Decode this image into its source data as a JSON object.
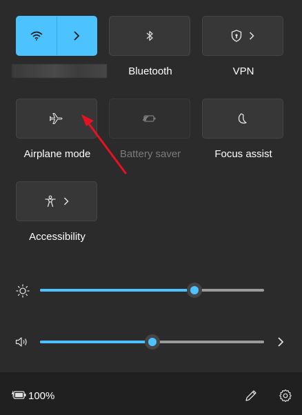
{
  "tiles": [
    {
      "label": "",
      "icon": "wifi-icon",
      "state": "active",
      "expand": true
    },
    {
      "label": "Bluetooth",
      "icon": "bluetooth-icon",
      "state": "off"
    },
    {
      "label": "VPN",
      "icon": "shield-icon",
      "state": "off",
      "expand": true
    },
    {
      "label": "Airplane mode",
      "icon": "airplane-icon",
      "state": "off"
    },
    {
      "label": "Battery saver",
      "icon": "battery-saver-icon",
      "state": "disabled"
    },
    {
      "label": "Focus assist",
      "icon": "moon-icon",
      "state": "off"
    },
    {
      "label": "Accessibility",
      "icon": "accessibility-icon",
      "state": "off",
      "expand": true
    }
  ],
  "sliders": {
    "brightness": {
      "icon": "sun-icon",
      "level": 0.69
    },
    "volume": {
      "icon": "speaker-icon",
      "level": 0.5
    }
  },
  "footer": {
    "battery_text": "100%",
    "battery_icon": "battery-charging-icon",
    "edit_icon": "pencil-icon",
    "settings_icon": "gear-icon"
  },
  "colors": {
    "accent": "#4cc2ff",
    "panel": "#2b2b2b",
    "tile": "#373737",
    "footer": "#202020"
  }
}
